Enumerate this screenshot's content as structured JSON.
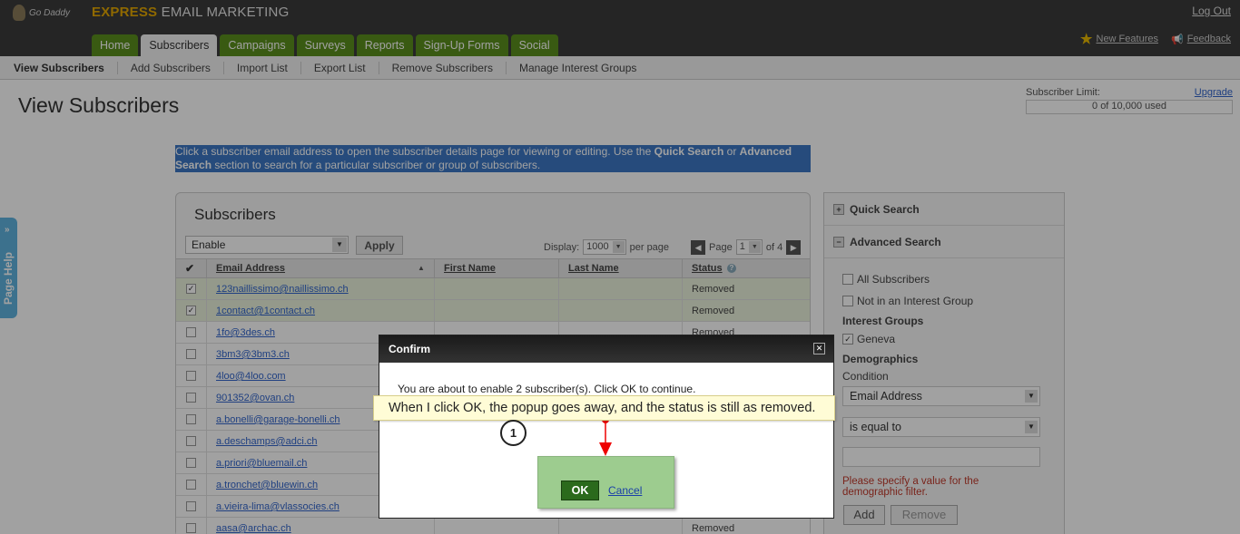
{
  "header": {
    "brand_highlight": "EXPRESS",
    "brand_rest": "EMAIL MARKETING",
    "logo_text": "Go Daddy",
    "logout": "Log Out",
    "new_features": "New Features",
    "feedback": "Feedback"
  },
  "tabs": [
    "Home",
    "Subscribers",
    "Campaigns",
    "Surveys",
    "Reports",
    "Sign-Up Forms",
    "Social"
  ],
  "subnav": [
    "View Subscribers",
    "Add Subscribers",
    "Import List",
    "Export List",
    "Remove Subscribers",
    "Manage Interest Groups"
  ],
  "page": {
    "title": "View Subscribers",
    "limit_label": "Subscriber Limit:",
    "upgrade": "Upgrade",
    "limit_value": "0 of 10,000 used"
  },
  "intro": {
    "a": "Click a subscriber email address to open the subscriber details page for viewing or editing. Use the ",
    "quick": "Quick Search",
    "or": " or ",
    "advanced": "Advanced Search",
    "b": " section to search for a particular subscriber or group of subscribers."
  },
  "pagehelp": "Page Help",
  "panel": {
    "title": "Subscribers",
    "bulk_action": "Enable",
    "apply": "Apply",
    "display_label": "Display:",
    "display_value": "1000",
    "per_page": "per page",
    "page_label": "Page",
    "page_value": "1",
    "of_pages": "of 4"
  },
  "table": {
    "headers": [
      "Email Address",
      "First Name",
      "Last Name",
      "Status"
    ],
    "rows": [
      {
        "email": "123naillissimo@naillissimo.ch",
        "status": "Removed",
        "checked": true
      },
      {
        "email": "1contact@1contact.ch",
        "status": "Removed",
        "checked": true
      },
      {
        "email": "1fo@3des.ch",
        "status": "Removed",
        "checked": false
      },
      {
        "email": "3bm3@3bm3.ch",
        "status": "",
        "checked": false
      },
      {
        "email": "4loo@4loo.com",
        "status": "",
        "checked": false
      },
      {
        "email": "901352@ovan.ch",
        "status": "",
        "checked": false
      },
      {
        "email": "a.bonelli@garage-bonelli.ch",
        "status": "",
        "checked": false
      },
      {
        "email": "a.deschamps@adci.ch",
        "status": "",
        "checked": false
      },
      {
        "email": "a.priori@bluemail.ch",
        "status": "",
        "checked": false
      },
      {
        "email": "a.tronchet@bluewin.ch",
        "status": "",
        "checked": false
      },
      {
        "email": "a.vieira-lima@vlassocies.ch",
        "status": "",
        "checked": false
      },
      {
        "email": "aasa@archac.ch",
        "status": "Removed",
        "checked": false
      }
    ]
  },
  "search": {
    "quick": "Quick Search",
    "advanced": "Advanced Search",
    "all": "All Subscribers",
    "not_in_group": "Not in an Interest Group",
    "interest_groups": "Interest Groups",
    "geneva": "Geneva",
    "demographics": "Demographics",
    "condition": "Condition",
    "field": "Email Address",
    "operator": "is equal to",
    "error": "Please specify a value for the demographic filter.",
    "add": "Add",
    "remove": "Remove"
  },
  "dialog": {
    "title": "Confirm",
    "message": "You are about to enable 2 subscriber(s). Click OK to continue.",
    "ok": "OK",
    "cancel": "Cancel"
  },
  "annotation": {
    "step": "1",
    "text": "When I click OK, the popup goes away, and the status is still as removed."
  }
}
